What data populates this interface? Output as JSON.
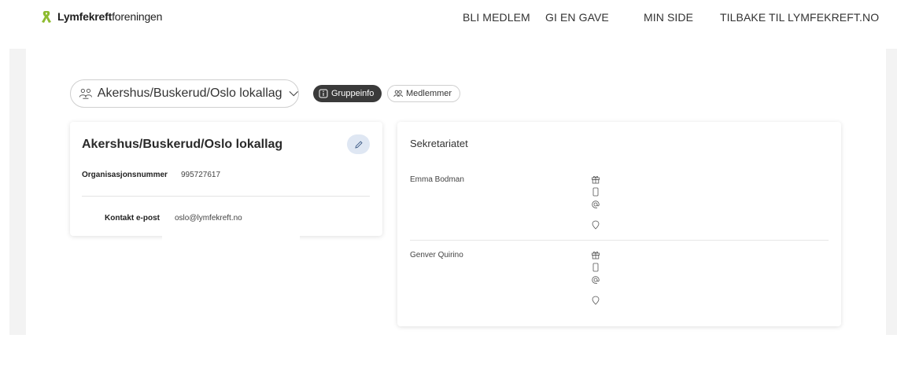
{
  "header": {
    "logo_bold": "Lymfekreft",
    "logo_regular": "foreningen",
    "nav": [
      "BLI MEDLEM",
      "GI EN GAVE",
      "MIN SIDE",
      "TILBAKE TIL LYMFEKREFT.NO"
    ]
  },
  "group_selector": {
    "selected": "Akershus/Buskerud/Oslo lokallag"
  },
  "tabs": {
    "info": "Gruppeinfo",
    "members": "Medlemmer"
  },
  "org_card": {
    "title": "Akershus/Buskerud/Oslo lokallag",
    "orgnr_label": "Organisasjonsnummer",
    "orgnr_value": "995727617",
    "email_label": "Kontakt e-post",
    "email_value": "oslo@lymfekreft.no"
  },
  "secretariat": {
    "title": "Sekretariatet",
    "members": [
      {
        "name": "Emma Bodman"
      },
      {
        "name": "Genver Quirino"
      }
    ],
    "detail_icons": [
      "gift-icon",
      "phone-icon",
      "at-icon",
      "location-pin-icon"
    ]
  },
  "colors": {
    "active_tab": "#3a3a3a",
    "edit_button": "#dfe7f3",
    "canvas": "#f3f3f3"
  }
}
